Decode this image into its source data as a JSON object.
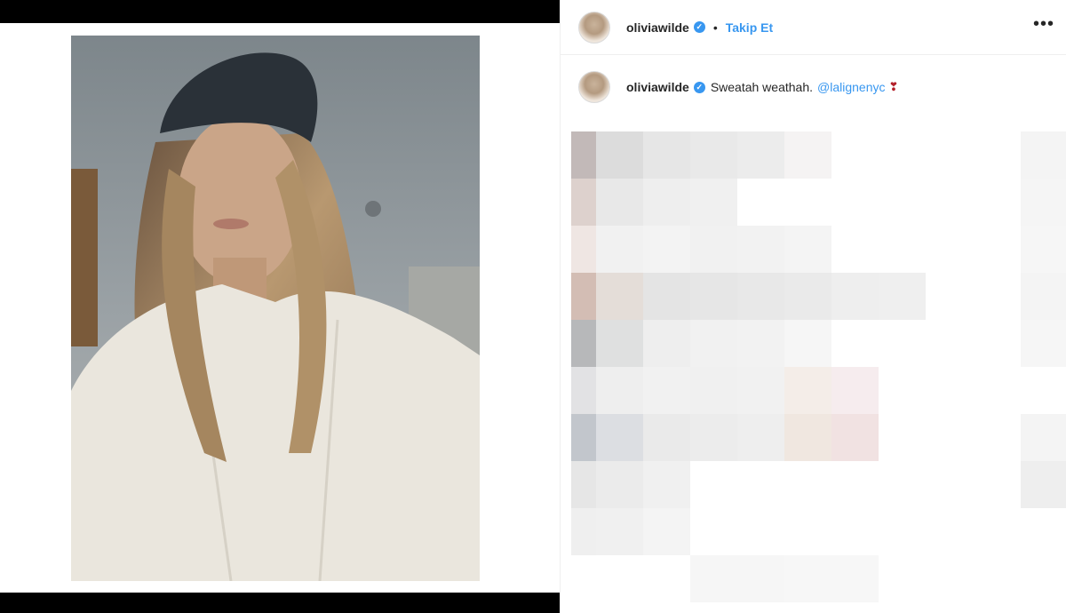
{
  "post": {
    "username": "oliviawilde",
    "follow_label": "Takip Et",
    "separator": "•",
    "more_icon": "•••",
    "caption_text": "Sweatah weathah.",
    "caption_mention": "@lalignenyc",
    "caption_emoji": "❣"
  },
  "colors": {
    "accent": "#3897f0",
    "text": "#262626",
    "heart": "#b3202a"
  }
}
